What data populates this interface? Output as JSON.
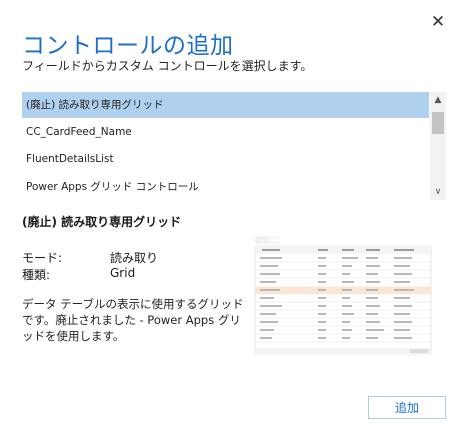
{
  "dialog": {
    "close_glyph": "✕",
    "title": "コントロールの追加",
    "subtitle": "フィールドからカスタム コントロールを選択します。"
  },
  "list": {
    "items": [
      {
        "label": "(廃止) 読み取り専用グリッド",
        "selected": true
      },
      {
        "label": "CC_CardFeed_Name",
        "selected": false
      },
      {
        "label": "FluentDetailsList",
        "selected": false
      },
      {
        "label": "Power Apps グリッド コントロール",
        "selected": false
      }
    ],
    "scroll_up_glyph": "▲",
    "scroll_down_glyph": "∨"
  },
  "detail": {
    "title": "(廃止) 読み取り専用グリッド",
    "mode_label": "モード:",
    "mode_value": "読み取り",
    "type_label": "種類:",
    "type_value": "Grid",
    "description": "データ テーブルの表示に使用するグリッドです。廃止されました - Power Apps グリッドを使用します。"
  },
  "add_button_label": "追加",
  "colors": {
    "accent": "#1b6fc9",
    "selection": "#b0d0ef"
  }
}
